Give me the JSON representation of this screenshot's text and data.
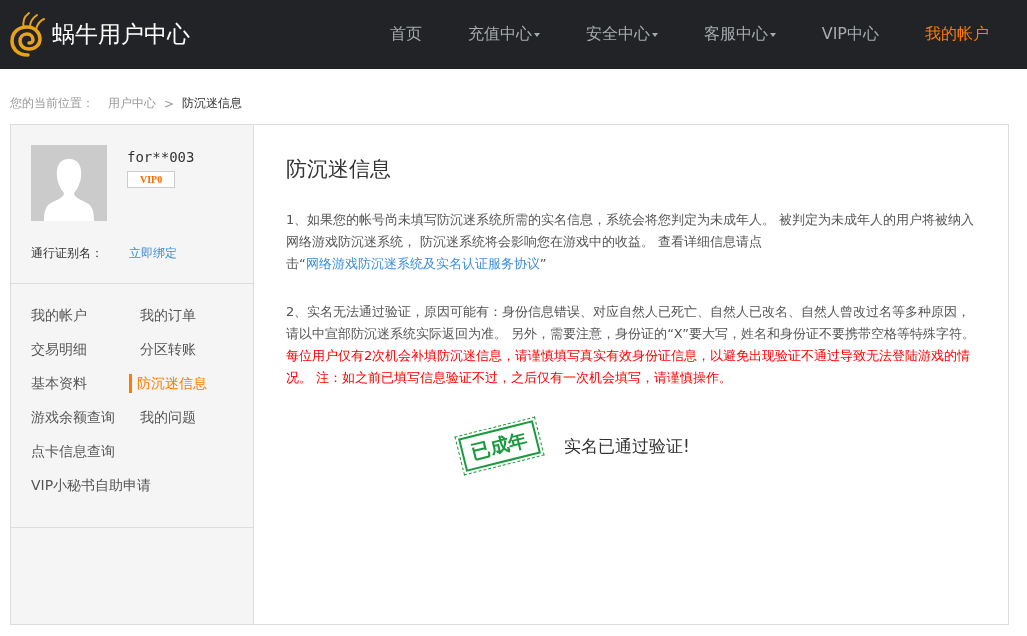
{
  "header": {
    "logo_text": "蜗牛用户中心",
    "nav": [
      {
        "label": "首页",
        "dropdown": false,
        "selected": false
      },
      {
        "label": "充值中心",
        "dropdown": true,
        "selected": false
      },
      {
        "label": "安全中心",
        "dropdown": true,
        "selected": false
      },
      {
        "label": "客服中心",
        "dropdown": true,
        "selected": false
      },
      {
        "label": "VIP中心",
        "dropdown": false,
        "selected": false
      },
      {
        "label": "我的帐户",
        "dropdown": false,
        "selected": true
      }
    ]
  },
  "breadcrumb": {
    "prefix": "您的当前位置：",
    "items": [
      "用户中心",
      "防沉迷信息"
    ],
    "separator": ">"
  },
  "sidebar": {
    "username": "for**003",
    "vip_badge": "VIP0",
    "alias_label": "通行证别名：",
    "alias_action": "立即绑定",
    "menu": [
      [
        {
          "label": "我的帐户",
          "selected": false
        },
        {
          "label": "我的订单",
          "selected": false
        }
      ],
      [
        {
          "label": "交易明细",
          "selected": false
        },
        {
          "label": "分区转账",
          "selected": false
        }
      ],
      [
        {
          "label": "基本资料",
          "selected": false
        },
        {
          "label": "防沉迷信息",
          "selected": true
        }
      ],
      [
        {
          "label": "游戏余额查询",
          "selected": false
        },
        {
          "label": "我的问题",
          "selected": false
        }
      ],
      [
        {
          "label": "点卡信息查询",
          "selected": false
        }
      ],
      [
        {
          "label": "VIP小秘书自助申请",
          "selected": false
        }
      ]
    ]
  },
  "main": {
    "title": "防沉迷信息",
    "paragraphs": [
      [
        {
          "kind": "plain",
          "text": "1、如果您的帐号尚未填写防沉迷系统所需的实名信息，系统会将您判定为未成年人。 被判定为未成年人的用户将被纳入网络游戏防沉迷系统， 防沉迷系统将会影响您在游戏中的收益。 查看详细信息请点击“"
        },
        {
          "kind": "link",
          "text": "网络游戏防沉迷系统及实名认证服务协议"
        },
        {
          "kind": "plain",
          "text": "”"
        }
      ],
      [
        {
          "kind": "plain",
          "text": "2、实名无法通过验证，原因可能有：身份信息错误、对应自然人已死亡、自然人已改名、自然人曾改过名等多种原因，请以中宣部防沉迷系统实际返回为准。 另外，需要注意，身份证的“X”要大写，姓名和身份证不要携带空格等特殊字符。 "
        },
        {
          "kind": "warning",
          "text": "每位用户仅有2次机会补填防沉迷信息，请谨慎填写真实有效身份证信息，以避免出现验证不通过导致无法登陆游戏的情况。 注：如之前已填写信息验证不过，之后仅有一次机会填写，请谨慎操作。"
        }
      ]
    ],
    "stamp": "已成年",
    "status": "实名已通过验证!"
  }
}
